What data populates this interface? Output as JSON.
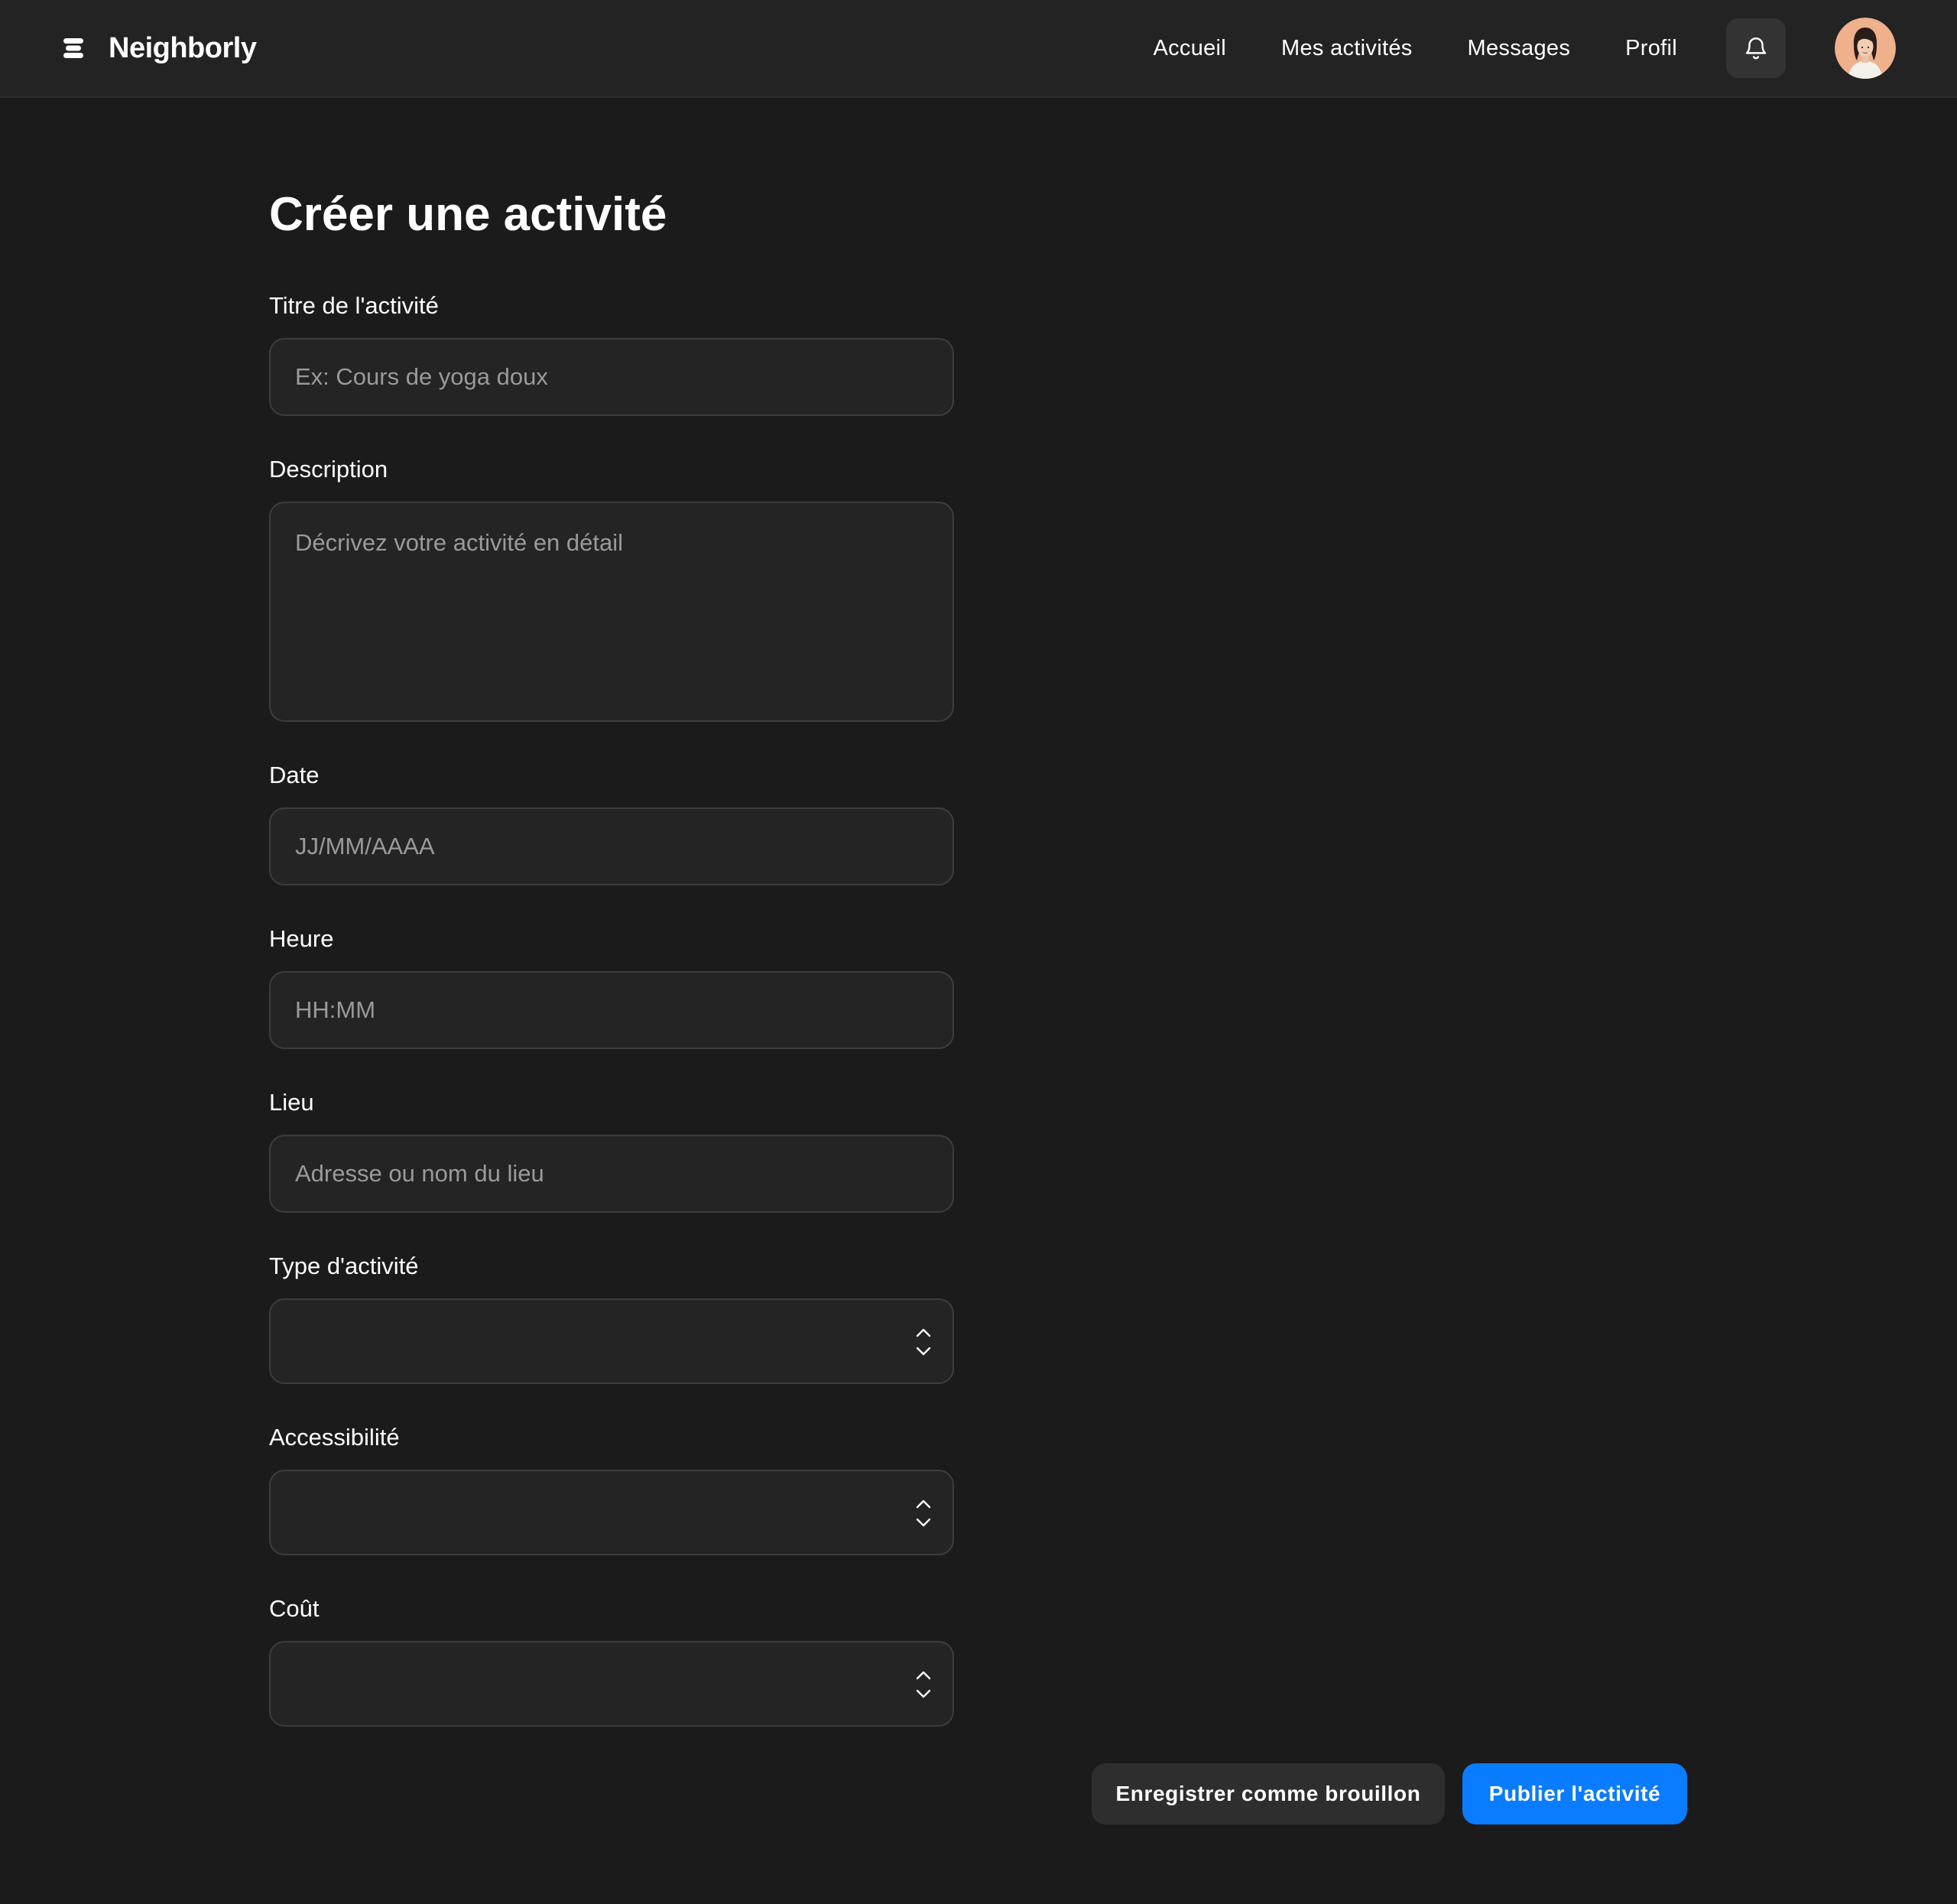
{
  "brand": {
    "name": "Neighborly"
  },
  "nav": {
    "items": [
      {
        "label": "Accueil"
      },
      {
        "label": "Mes activités"
      },
      {
        "label": "Messages"
      },
      {
        "label": "Profil"
      }
    ],
    "notification_icon": "bell-icon",
    "avatar_icon": "user-avatar"
  },
  "page": {
    "title": "Créer une activité"
  },
  "form": {
    "title": {
      "label": "Titre de l'activité",
      "placeholder": "Ex: Cours de yoga doux",
      "value": ""
    },
    "description": {
      "label": "Description",
      "placeholder": "Décrivez votre activité en détail",
      "value": ""
    },
    "date": {
      "label": "Date",
      "placeholder": "JJ/MM/AAAA",
      "value": ""
    },
    "time": {
      "label": "Heure",
      "placeholder": "HH:MM",
      "value": ""
    },
    "location": {
      "label": "Lieu",
      "placeholder": "Adresse ou nom du lieu",
      "value": ""
    },
    "activity_type": {
      "label": "Type d'activité",
      "selected": ""
    },
    "accessibility": {
      "label": "Accessibilité",
      "selected": ""
    },
    "cost": {
      "label": "Coût",
      "selected": ""
    }
  },
  "actions": {
    "save_draft_label": "Enregistrer comme brouillon",
    "publish_label": "Publier l'activité"
  },
  "colors": {
    "background": "#1b1b1b",
    "topbar": "#232323",
    "input_background": "#242424",
    "input_border": "#3d3d3d",
    "primary": "#0a7cff",
    "secondary_button": "#2e2e2e"
  }
}
